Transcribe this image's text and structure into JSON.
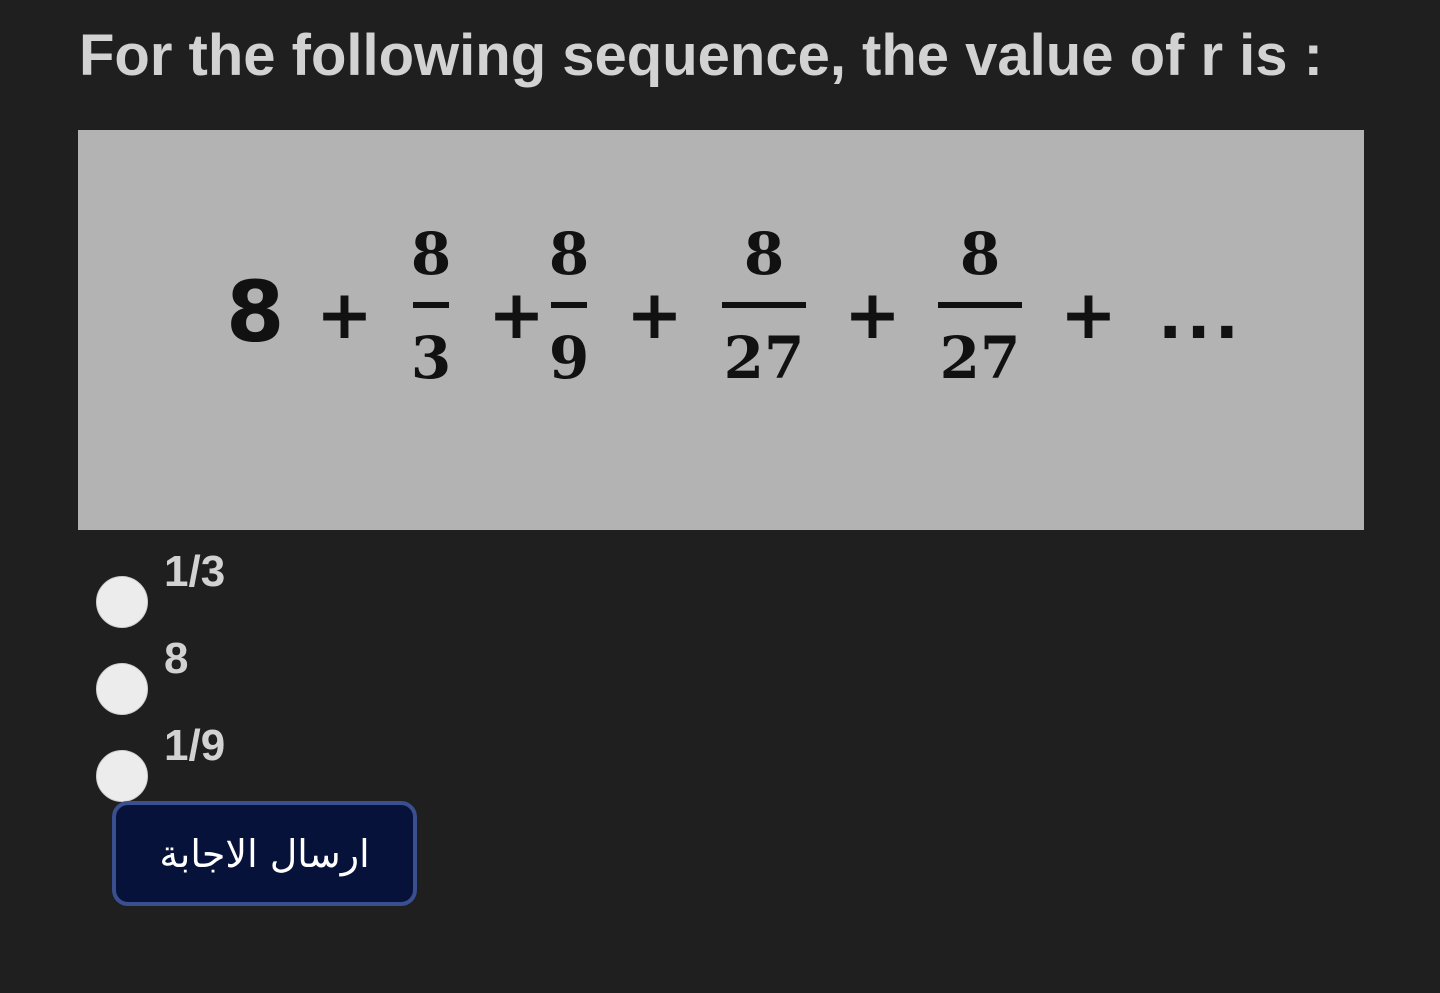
{
  "question": {
    "title": "For the following sequence, the value of r is :"
  },
  "equation": {
    "lead": "8",
    "plus": "+",
    "terms": [
      {
        "numerator": "8",
        "denominator": "3"
      },
      {
        "numerator": "8",
        "denominator": "9"
      },
      {
        "numerator": "8",
        "denominator": "27"
      },
      {
        "numerator": "8",
        "denominator": "27"
      }
    ],
    "ellipsis": "..."
  },
  "options": [
    {
      "label": "1/3"
    },
    {
      "label": "8"
    },
    {
      "label": "1/9"
    }
  ],
  "submit": {
    "label": "ارسال الاجابة"
  }
}
